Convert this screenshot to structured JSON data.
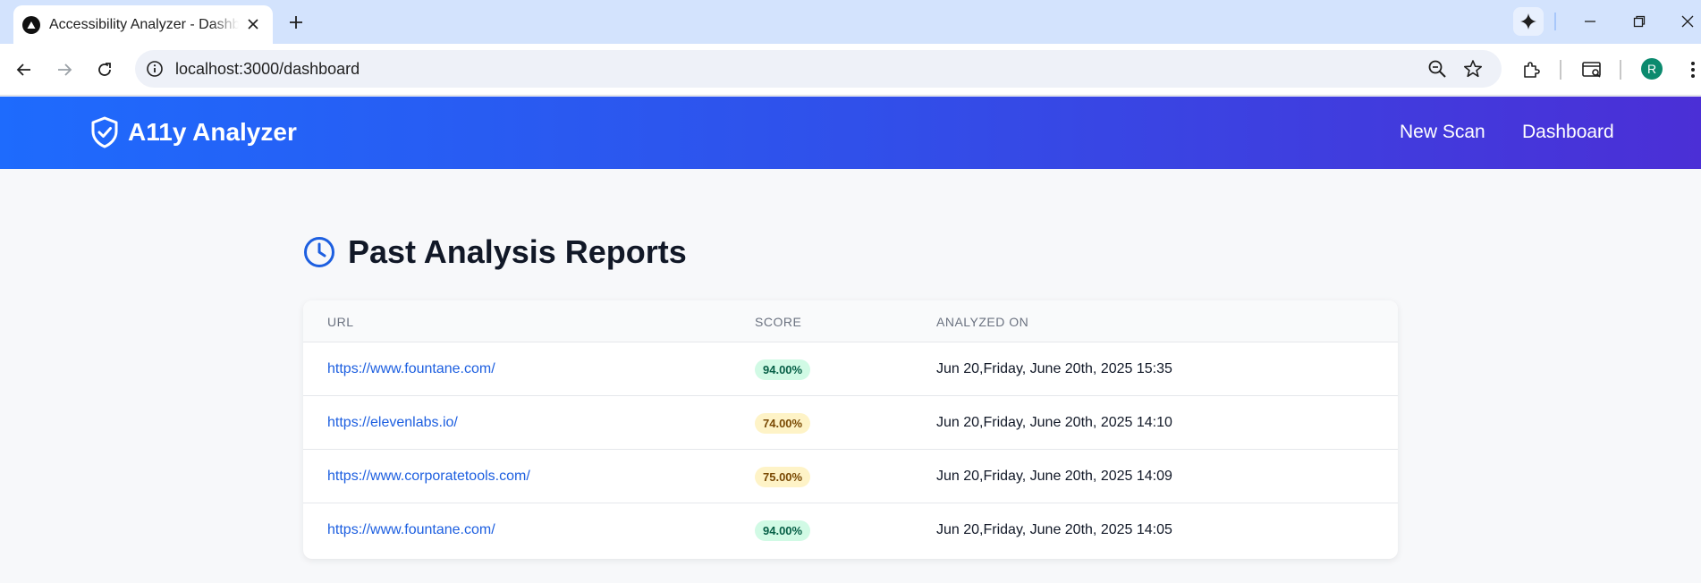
{
  "browser": {
    "tab_title": "Accessibility Analyzer - Dashboard",
    "url": "localhost:3000/dashboard",
    "profile_initial": "R"
  },
  "header": {
    "brand": "A11y Analyzer",
    "nav": [
      "New Scan",
      "Dashboard"
    ]
  },
  "page": {
    "title": "Past Analysis Reports",
    "columns": [
      "URL",
      "SCORE",
      "ANALYZED ON"
    ],
    "rows": [
      {
        "url": "https://www.fountane.com/",
        "score": "94.00%",
        "score_level": "green",
        "analyzed_on": "Jun 20,Friday, June 20th, 2025 15:35"
      },
      {
        "url": "https://elevenlabs.io/",
        "score": "74.00%",
        "score_level": "yellow",
        "analyzed_on": "Jun 20,Friday, June 20th, 2025 14:10"
      },
      {
        "url": "https://www.corporatetools.com/",
        "score": "75.00%",
        "score_level": "yellow",
        "analyzed_on": "Jun 20,Friday, June 20th, 2025 14:09"
      },
      {
        "url": "https://www.fountane.com/",
        "score": "94.00%",
        "score_level": "green",
        "analyzed_on": "Jun 20,Friday, June 20th, 2025 14:05"
      }
    ]
  },
  "colors": {
    "header_gradient_start": "#1e6bfd",
    "header_gradient_end": "#4b2fd6",
    "link": "#1d5fe0",
    "badge_green_bg": "#d1fae5",
    "badge_yellow_bg": "#fef3c7"
  },
  "icons": {
    "brand": "shield-check-icon",
    "heading": "clock-icon"
  }
}
